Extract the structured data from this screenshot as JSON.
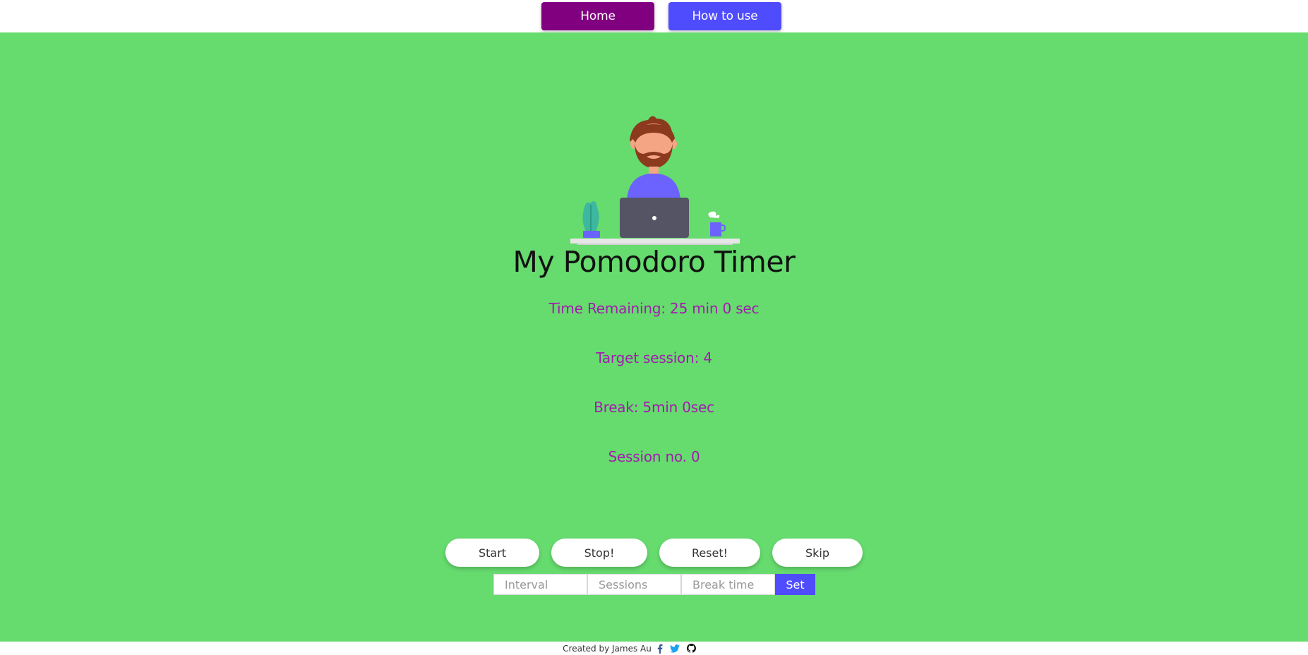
{
  "nav": {
    "home_label": "Home",
    "howto_label": "How to use"
  },
  "main": {
    "title": "My Pomodoro Timer",
    "time_remaining": "Time Remaining: 25 min 0 sec",
    "target_session": "Target session: 4",
    "break": "Break: 5min 0sec",
    "session_no": "Session no. 0"
  },
  "controls": {
    "start": "Start",
    "stop": "Stop!",
    "reset": "Reset!",
    "skip": "Skip"
  },
  "inputs": {
    "interval_placeholder": "Interval",
    "sessions_placeholder": "Sessions",
    "break_placeholder": "Break time",
    "set_label": "Set"
  },
  "footer": {
    "credit": "Created by James Au",
    "icons": [
      "facebook-icon",
      "twitter-icon",
      "github-icon"
    ]
  },
  "colors": {
    "background": "#66db6e",
    "home_button": "#800080",
    "howto_button": "#4f4cfe",
    "stat_text": "#a21caf",
    "set_button": "#4f4cfe"
  }
}
